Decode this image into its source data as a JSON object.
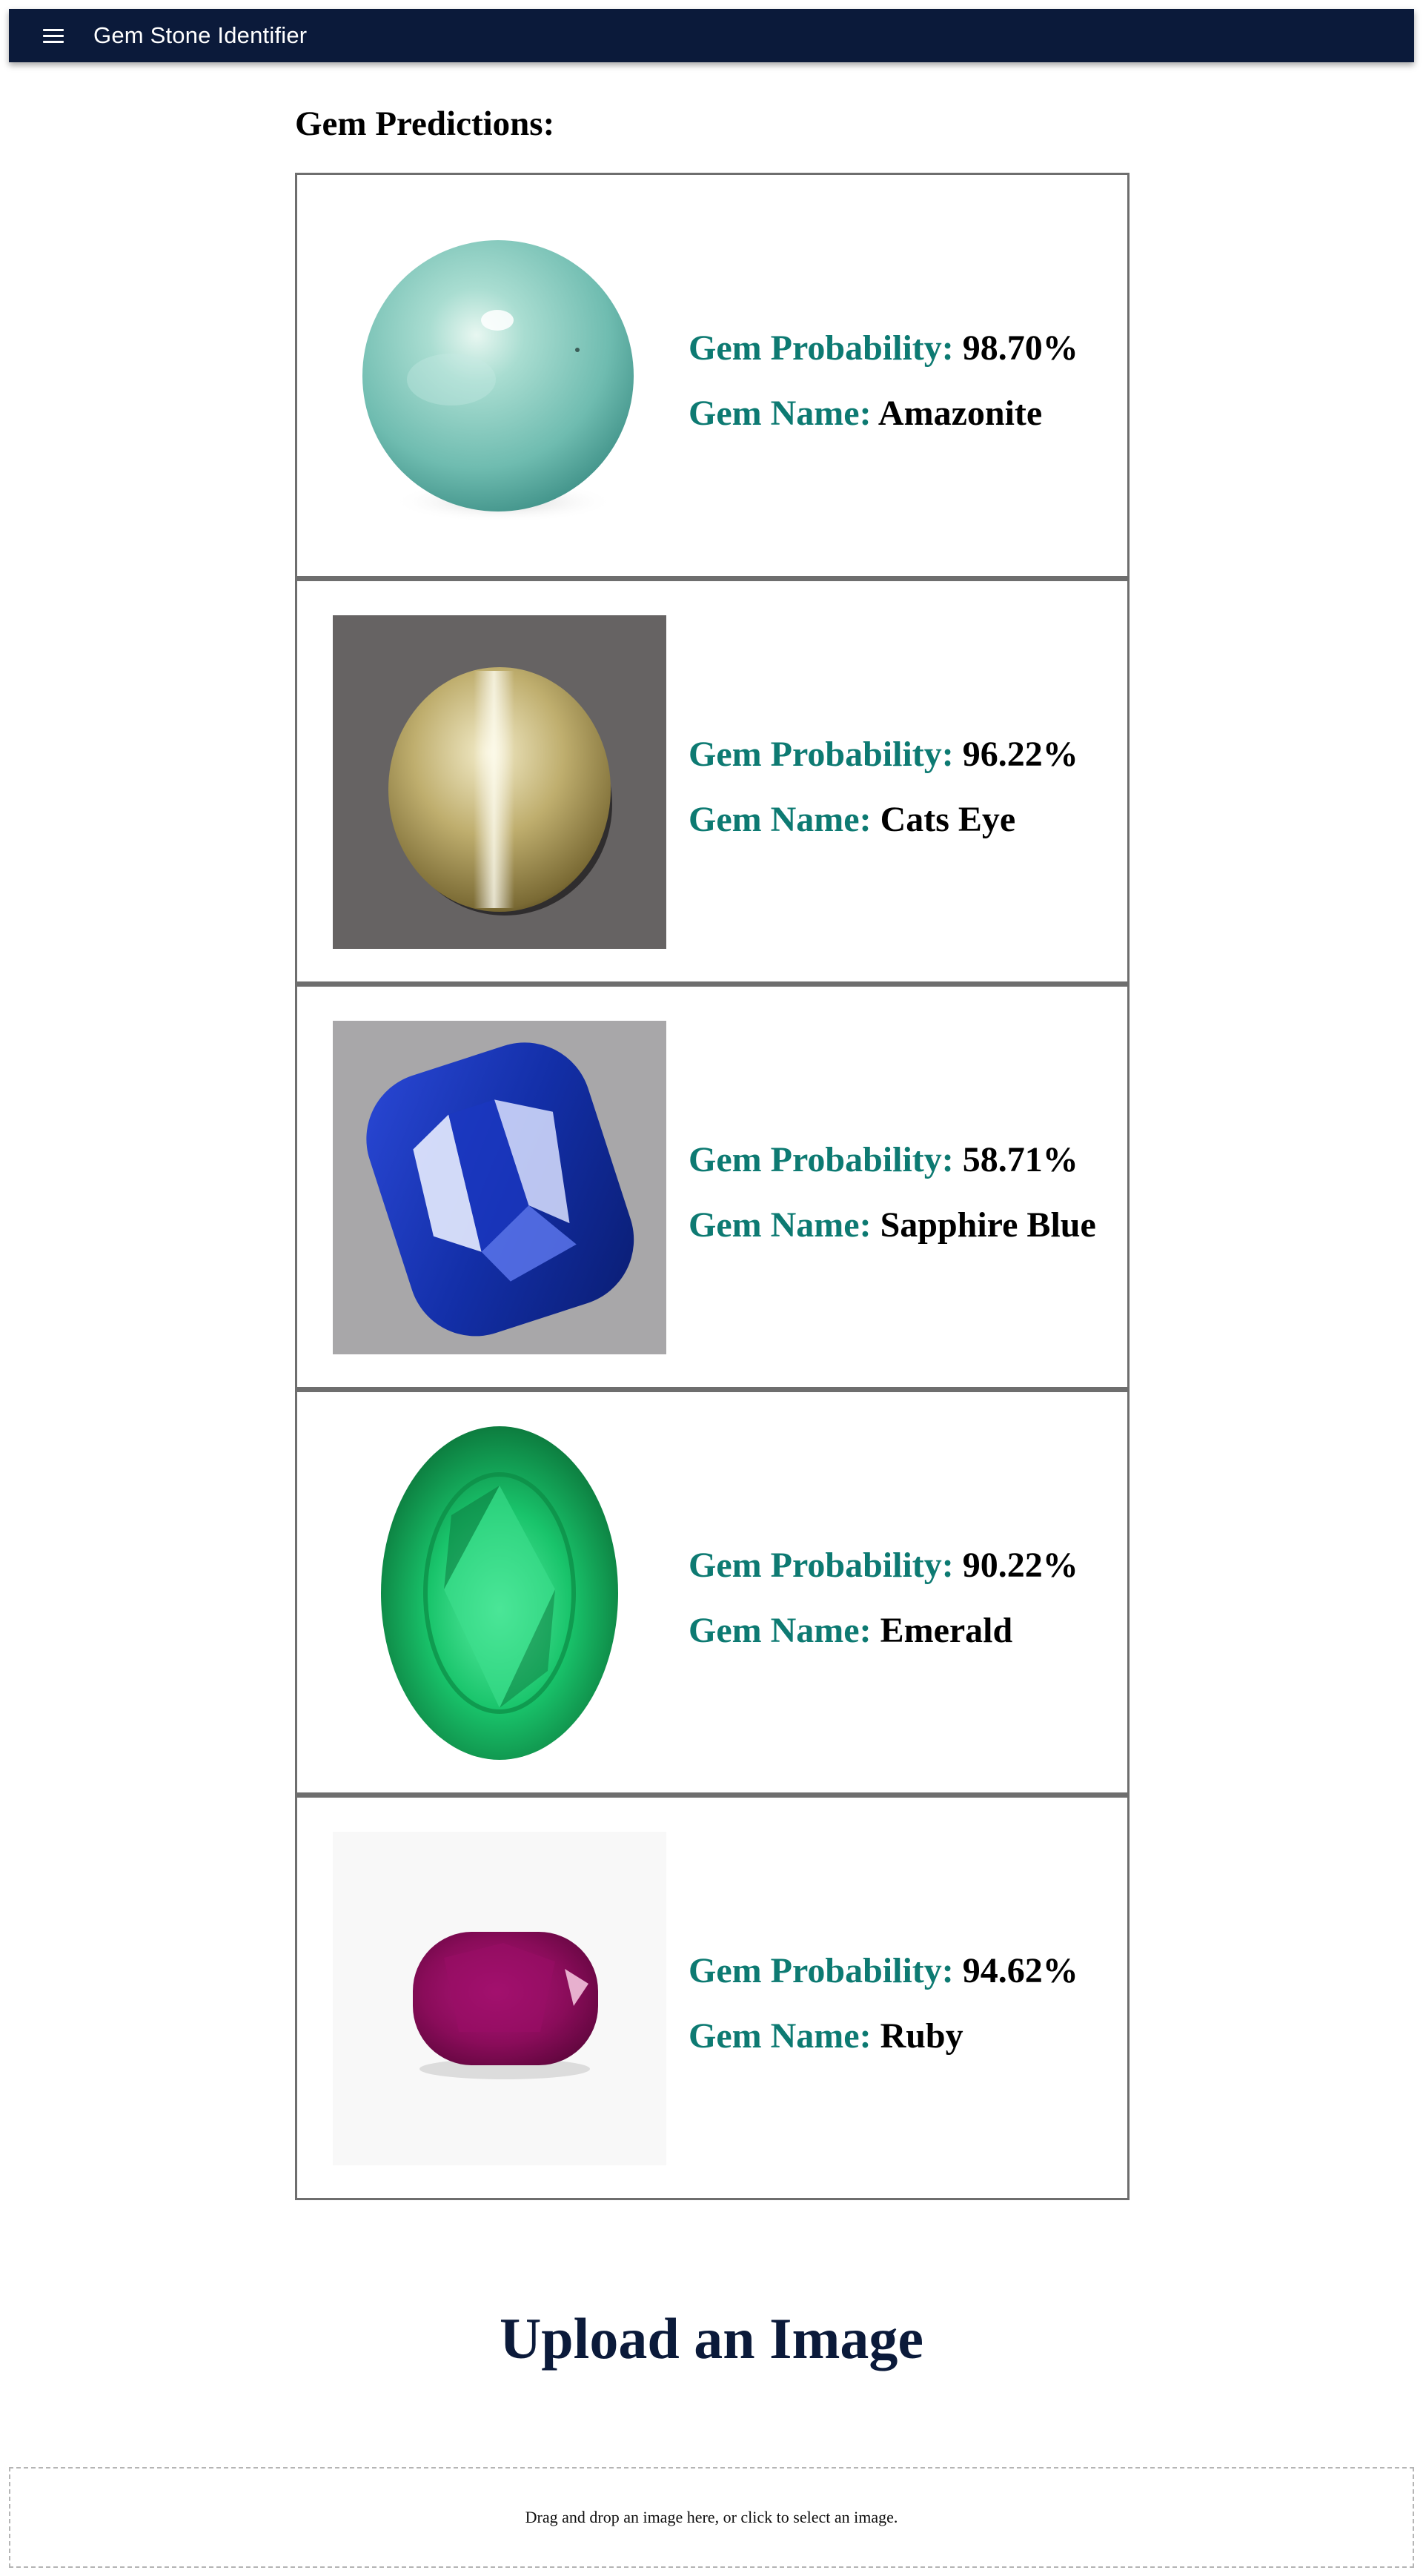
{
  "app": {
    "title": "Gem Stone Identifier",
    "menu_icon": "menu-icon"
  },
  "predictions": {
    "title": "Gem Predictions:",
    "probability_label": "Gem Probability:",
    "name_label": "Gem Name:",
    "items": [
      {
        "probability": "98.70%",
        "name": "Amazonite",
        "image_desc": "amazonite-sphere"
      },
      {
        "probability": "96.22%",
        "name": "Cats Eye",
        "image_desc": "cats-eye-cabochon"
      },
      {
        "probability": "58.71%",
        "name": "Sapphire Blue",
        "image_desc": "blue-sapphire"
      },
      {
        "probability": "90.22%",
        "name": "Emerald",
        "image_desc": "oval-emerald"
      },
      {
        "probability": "94.62%",
        "name": "Ruby",
        "image_desc": "cushion-ruby"
      }
    ]
  },
  "upload": {
    "heading": "Upload an Image",
    "dropzone_text": "Drag and drop an image here, or click to select an image."
  },
  "colors": {
    "appbar": "#0b1a3a",
    "label_teal": "#0d7a72",
    "heading_navy": "#0b1a3a"
  }
}
